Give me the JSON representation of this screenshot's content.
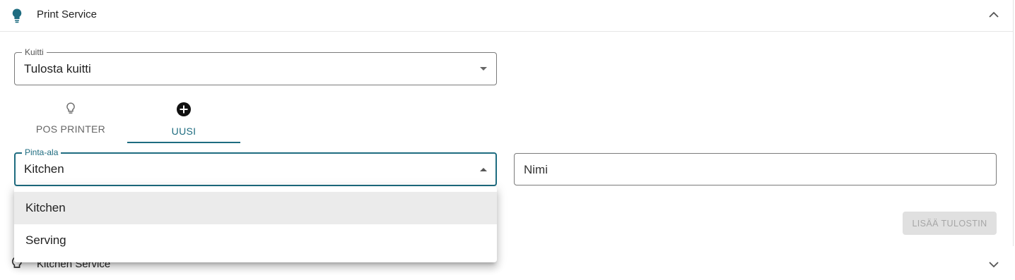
{
  "print_service": {
    "title": "Print Service",
    "receipt_field": {
      "label": "Kuitti",
      "value": "Tulosta kuitti"
    },
    "tabs": [
      {
        "label": "POS PRINTER",
        "icon": "lightbulb-outline-icon"
      },
      {
        "label": "UUSI",
        "icon": "add-circle-icon"
      }
    ],
    "area_field": {
      "label": "Pinta-ala",
      "value": "Kitchen"
    },
    "name_field": {
      "placeholder": "Nimi"
    },
    "add_button_label": "LISÄÄ TULOSTIN"
  },
  "kitchen_service": {
    "title": "Kitchen Service"
  },
  "area_menu": {
    "options": [
      "Kitchen",
      "Serving"
    ],
    "selected": "Kitchen"
  },
  "colors": {
    "accent": "#1e6c80",
    "bulb": "#1e6c80"
  }
}
